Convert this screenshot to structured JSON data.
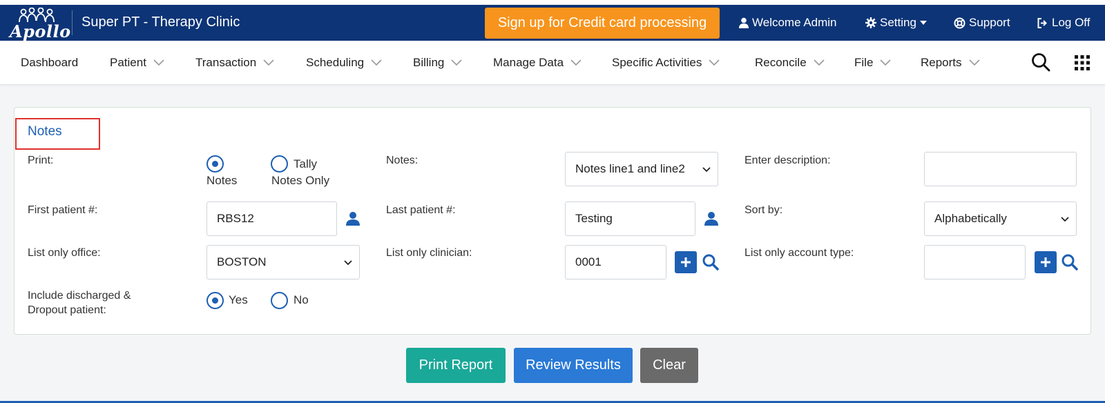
{
  "header": {
    "logo_text": "Apollo",
    "clinic_name": "Super PT - Therapy Clinic",
    "signup_label": "Sign up for Credit card processing",
    "welcome_label": "Welcome Admin",
    "setting_label": "Setting",
    "support_label": "Support",
    "logoff_label": "Log Off",
    "brand_color": "#0d3476",
    "accent_color": "#f7941d"
  },
  "nav": {
    "items": [
      {
        "label": "Dashboard"
      },
      {
        "label": "Patient"
      },
      {
        "label": "Transaction"
      },
      {
        "label": "Scheduling"
      },
      {
        "label": "Billing"
      },
      {
        "label": "Manage Data"
      },
      {
        "label": "Specific Activities"
      },
      {
        "label": "Reconcile"
      },
      {
        "label": "File"
      },
      {
        "label": "Reports"
      }
    ],
    "icons": [
      "search-icon",
      "apps-grid-icon"
    ]
  },
  "form": {
    "title": "Notes",
    "print": {
      "label": "Print:",
      "option_notes_line1": "",
      "option_notes": "Notes",
      "option_tally_line1": "Tally",
      "option_tally_line2": "Notes Only",
      "selected": "Notes"
    },
    "notes": {
      "label": "Notes:",
      "value": "Notes line1 and line2"
    },
    "description": {
      "label": "Enter description:",
      "value": ""
    },
    "first_patient": {
      "label": "First patient #:",
      "value": "RBS12"
    },
    "last_patient": {
      "label": "Last patient #:",
      "value": "Testing"
    },
    "sort_by": {
      "label": "Sort by:",
      "value": "Alphabetically"
    },
    "office": {
      "label": "List only office:",
      "value": "BOSTON"
    },
    "clinician": {
      "label": "List only clinician:",
      "value": "0001"
    },
    "account_type": {
      "label": "List only account type:",
      "value": ""
    },
    "discharged": {
      "label_line1": "Include discharged &",
      "label_line2": "Dropout patient:",
      "yes_label": "Yes",
      "no_label": "No",
      "selected": "Yes"
    }
  },
  "actions": {
    "print_label": "Print Report",
    "review_label": "Review Results",
    "clear_label": "Clear"
  }
}
